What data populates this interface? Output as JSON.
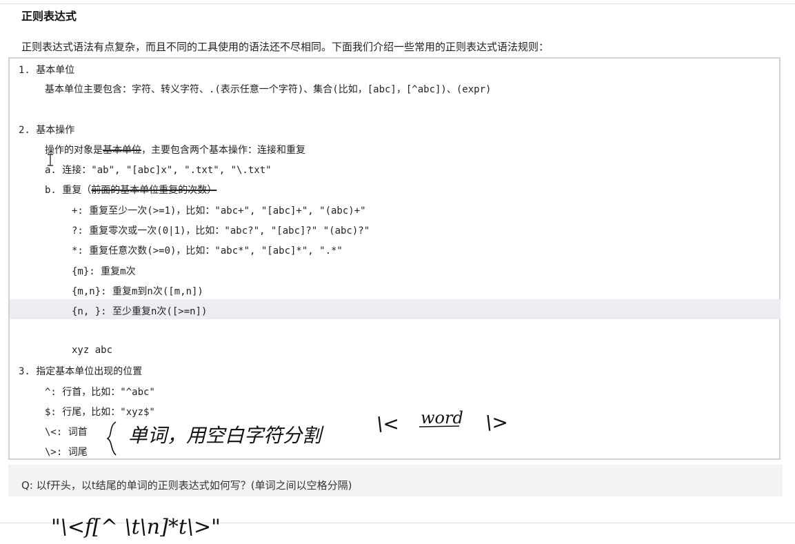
{
  "title": "正则表达式",
  "intro": "正则表达式语法有点复杂，而且不同的工具使用的语法还不尽相同。下面我们介绍一些常用的正则表达式语法规则：",
  "code": {
    "l1": "1. 基本单位",
    "l2": "基本单位主要包含：字符、转义字符、.(表示任意一个字符)、集合(比如，[abc]，[^abc])、(expr)",
    "l3": "2. 基本操作",
    "l4a": "操作的对象是",
    "l4b": "基本单位",
    "l4c": "，主要包含两个基本操作：连接和重复",
    "l5": "a. 连接：\"ab\", \"[abc]x\", \".txt\", \"\\.txt\"",
    "l6a": "b. 重复（",
    "l6b": "前面的基本单位重复的次数）",
    "l7": "+: 重复至少一次(>=1)，比如：\"abc+\", \"[abc]+\", \"(abc)+\"",
    "l8": "?: 重复零次或一次(0|1)，比如：\"abc?\", \"[abc]?\" \"(abc)?\"",
    "l9": "*: 重复任意次数(>=0)，比如：\"abc*\", \"[abc]*\", \".*\"",
    "l10": "{m}: 重复m次",
    "l11": "{m,n}: 重复m到n次([m,n])",
    "l12": "{n, }: 至少重复n次([>=n])",
    "l13": "xyz abc",
    "l14": "3. 指定基本单位出现的位置",
    "l15": "^: 行首，比如：\"^abc\"",
    "l16": "$: 行尾，比如：\"xyz$\"",
    "l17": "\\<: 词首",
    "l18": "\\>: 词尾"
  },
  "question": "Q: 以f开头，以t结尾的单词的正则表达式如何写？(单词之间以空格分隔)",
  "annotations": {
    "note_cn": "单词，用空白字符分割",
    "note_word": "word",
    "note_lt": "\\<",
    "note_gt": "\\>",
    "answer": "\"\\<f[^ \\t\\n]*t\\>\""
  },
  "colors": {
    "ink": "#111111",
    "box_border": "#cfd3d8",
    "highlight": "#ebedf0",
    "question_bg": "#f2f3f5"
  }
}
